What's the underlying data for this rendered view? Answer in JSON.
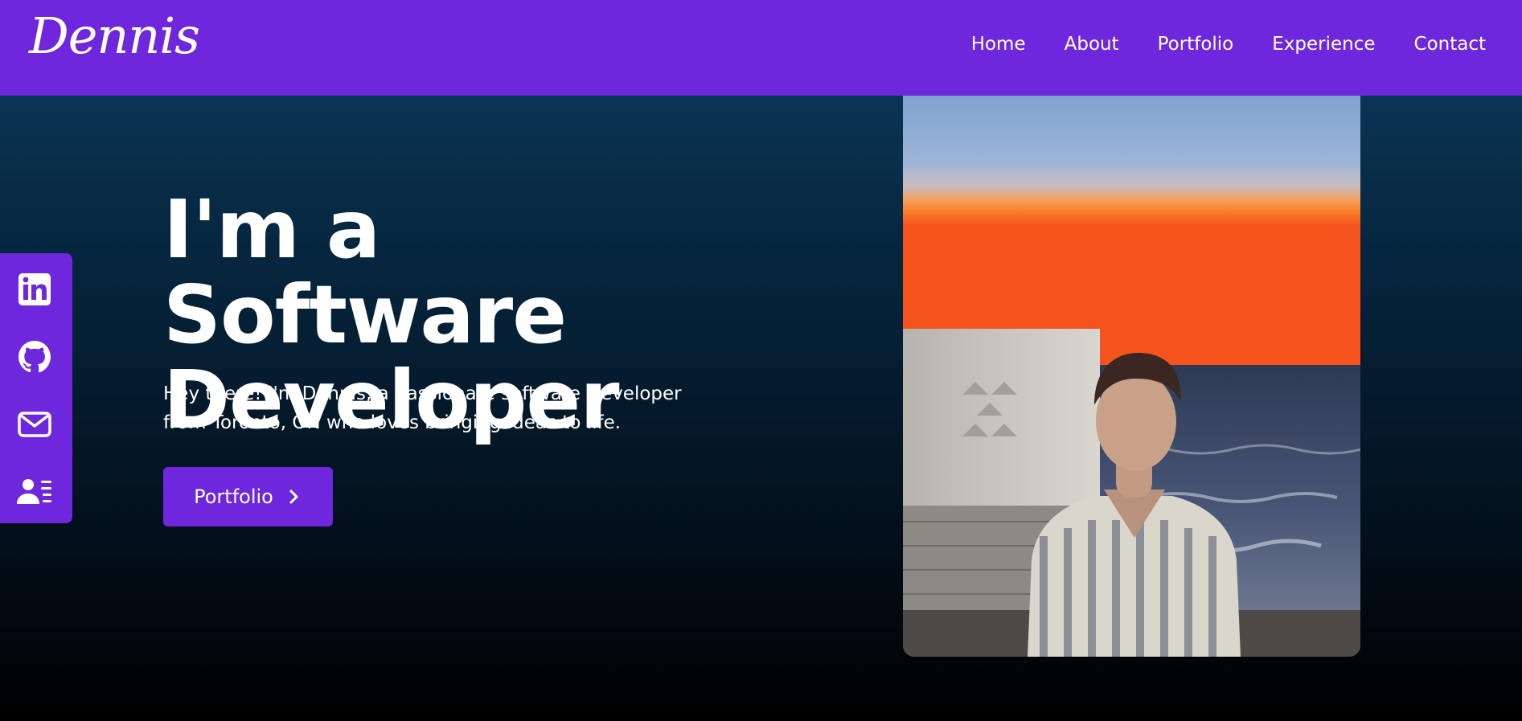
{
  "nav": {
    "logo": "Dennis",
    "links": [
      "Home",
      "About",
      "Portfolio",
      "Experience",
      "Contact"
    ]
  },
  "social": {
    "icons": [
      "linkedin-icon",
      "github-icon",
      "mail-icon",
      "resume-icon"
    ]
  },
  "hero": {
    "title_line1": "I'm a Software",
    "title_line2": "Developer",
    "description_line1": "Hey there! I'm Dennis, a passionate software Developer",
    "description_line2": "from Toronto, ON who loves bringing ideas to life.",
    "button_label": "Portfolio"
  },
  "colors": {
    "accent": "#6e27dc",
    "background_top": "#0c3d5f",
    "background_bottom": "#000000",
    "text": "#ffffff"
  }
}
